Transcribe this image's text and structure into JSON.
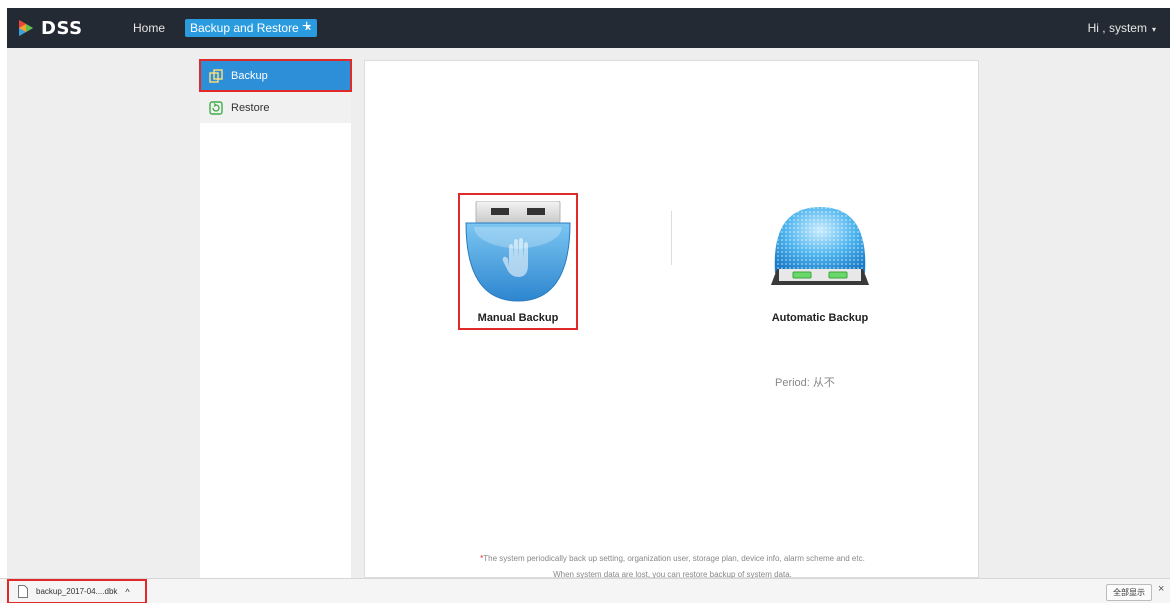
{
  "header": {
    "app_name": "DSS",
    "nav_home": "Home",
    "active_tab": "Backup and Restore",
    "tab_close_glyph": "×",
    "add_tab_glyph": "+",
    "user_greeting": "Hi , system",
    "user_caret": "▾"
  },
  "sidebar": {
    "items": [
      {
        "label": "Backup",
        "icon": "copy-icon",
        "active": true
      },
      {
        "label": "Restore",
        "icon": "restore-icon",
        "active": false
      }
    ]
  },
  "main": {
    "manual_backup_label": "Manual Backup",
    "automatic_backup_label": "Automatic Backup",
    "period_text": "Period:  从不",
    "note_star": "*",
    "note_line1": "The system periodically back up setting, organization user, storage plan, device info, alarm scheme and etc.",
    "note_line2": "When system data are lost, you can restore backup of system data."
  },
  "download_bar": {
    "filename": "backup_2017-04....dbk",
    "caret": "^",
    "show_all": "全部显示",
    "close": "×"
  },
  "colors": {
    "topbar": "#242a33",
    "accent": "#2b9be0",
    "highlight": "#e02a2a",
    "sidebar_active": "#2d8fd8"
  }
}
